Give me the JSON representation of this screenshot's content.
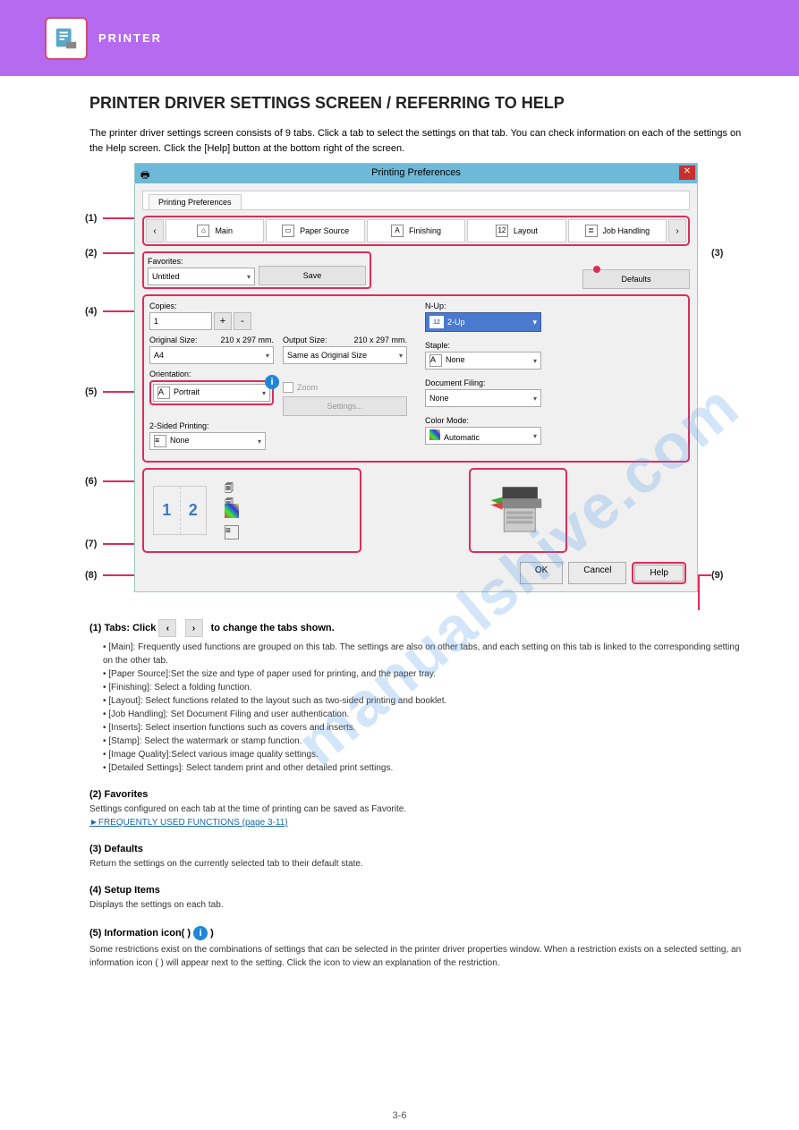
{
  "banner": {
    "chapter_label": "PRINTER"
  },
  "page_title": "PRINTER DRIVER SETTINGS SCREEN / REFERRING TO HELP",
  "intro": "The printer driver settings screen consists of 9 tabs. Click a tab to select the settings on that tab. You can check information on each of the settings on the Help screen. Click the [Help] button at the bottom right of the screen.",
  "dialog": {
    "title": "Printing Preferences",
    "outer_tab": "Printing Preferences",
    "nav_prev": "‹",
    "nav_next": "›",
    "tabs": {
      "main": "Main",
      "paper_source": "Paper Source",
      "finishing": "Finishing",
      "layout": "Layout",
      "job_handling": "Job Handling"
    },
    "favorites_label": "Favorites:",
    "favorites_value": "Untitled",
    "save_btn": "Save",
    "defaults_btn": "Defaults",
    "copies_label": "Copies:",
    "copies_value": "1",
    "plus_btn": "+",
    "minus_btn": "-",
    "original_size_label": "Original Size:",
    "original_size_dim": "210 x 297 mm.",
    "original_size_value": "A4",
    "output_size_label": "Output Size:",
    "output_size_dim": "210 x 297 mm.",
    "output_size_value": "Same as Original Size",
    "orientation_label": "Orientation:",
    "orientation_value": "Portrait",
    "zoom_label": "Zoom",
    "settings_btn": "Settings...",
    "two_sided_label": "2-Sided Printing:",
    "two_sided_value": "None",
    "nup_label": "N-Up:",
    "nup_value": "2-Up",
    "staple_label": "Staple:",
    "staple_value": "None",
    "doc_filing_label": "Document Filing:",
    "doc_filing_value": "None",
    "color_mode_label": "Color Mode:",
    "color_mode_value": "Automatic",
    "preview_1": "1",
    "preview_2": "2",
    "ok_btn": "OK",
    "cancel_btn": "Cancel",
    "help_btn": "Help"
  },
  "callouts": {
    "n1": "(1)",
    "n2": "(2)",
    "n3": "(3)",
    "n4": "(4)",
    "n5": "(5)",
    "n6": "(6)",
    "n7": "(7)",
    "n8": "(8)",
    "n9": "(9)"
  },
  "fn_marker1": "1",
  "fn_marker2": "2",
  "fn1_heading": "(1)  Tabs: Click ",
  "fn1_heading_b": " to change the tabs shown.",
  "fn1_bullets": {
    "main": "• [Main]:              Frequently used functions are grouped on this tab. The settings are also on other tabs, and each setting on this tab is linked to the corresponding setting on the other tab.",
    "paper": "• [Paper Source]:Set the size and type of paper used for printing, and the paper tray.",
    "finishing": "• [Finishing]:        Select a folding function.",
    "layout": "• [Layout]:           Select functions related to the layout such as two-sided printing and booklet.",
    "job": "• [Job Handling]: Set Document Filing and user authentication.",
    "inserts": "• [Inserts]:           Select insertion functions such as covers and inserts.",
    "stamp": "• [Stamp]:            Select the watermark or stamp function.",
    "quality": "• [Image Quality]:Select various image quality settings.",
    "detailed": "• [Detailed Settings]: Select tandem print and other detailed print settings."
  },
  "fn2_heading": "(2)  Favorites",
  "fn2_text": "Settings configured on each tab at the time of printing can be saved as Favorite.",
  "fn2_link": "►FREQUENTLY USED FUNCTIONS (page 3-11)",
  "fn3_heading": "(3)  Defaults",
  "fn3_text": "Return the settings on the currently selected tab to their default state.",
  "fn4_heading": "(4)  Setup Items",
  "fn4_text": "Displays the settings on each tab.",
  "fn5_heading": "(5)  Information icon(         )",
  "fn5_text": "Some restrictions exist on the combinations of settings that can be selected in the printer driver properties window. When a restriction exists on a selected setting, an information icon (       ) will appear next to the setting. Click the icon to view an explanation of the restriction.",
  "watermark": "manualshive.com",
  "page_num": "3-6"
}
